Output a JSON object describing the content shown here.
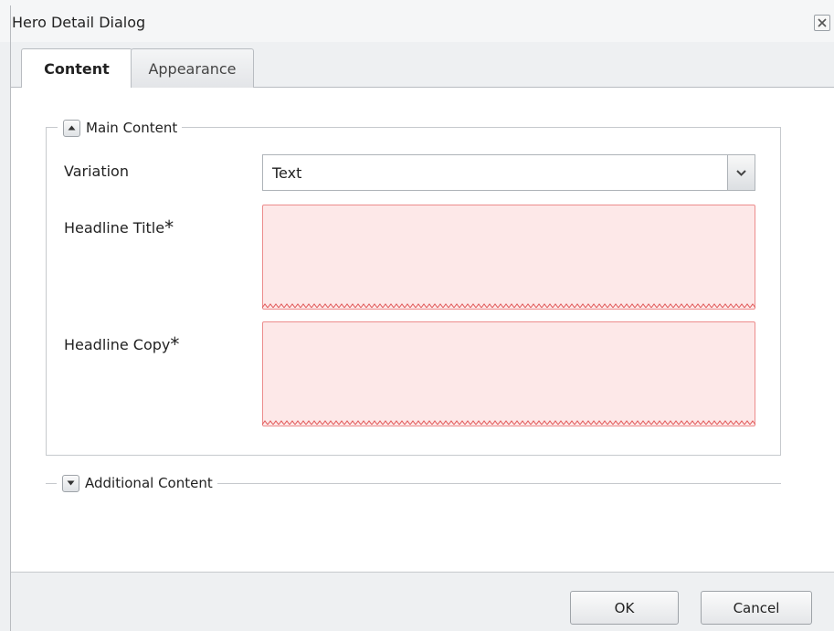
{
  "dialog": {
    "title": "Hero Detail Dialog",
    "close_icon": "close-icon"
  },
  "tabs": [
    {
      "label": "Content",
      "active": true
    },
    {
      "label": "Appearance",
      "active": false
    }
  ],
  "main_content": {
    "legend": "Main Content",
    "toggle_icon": "collapse-up-icon",
    "fields": {
      "variation": {
        "label": "Variation",
        "value": "Text"
      },
      "headline_title": {
        "label": "Headline Title",
        "required_mark": "*",
        "value": ""
      },
      "headline_copy": {
        "label": "Headline Copy",
        "required_mark": "*",
        "value": ""
      }
    }
  },
  "additional_content": {
    "legend": "Additional Content",
    "toggle_icon": "expand-down-icon"
  },
  "footer": {
    "ok_label": "OK",
    "cancel_label": "Cancel"
  },
  "colors": {
    "invalid_bg": "#fde8e8",
    "invalid_border": "#ec8c8c",
    "dialog_bg": "#eef0f2"
  }
}
